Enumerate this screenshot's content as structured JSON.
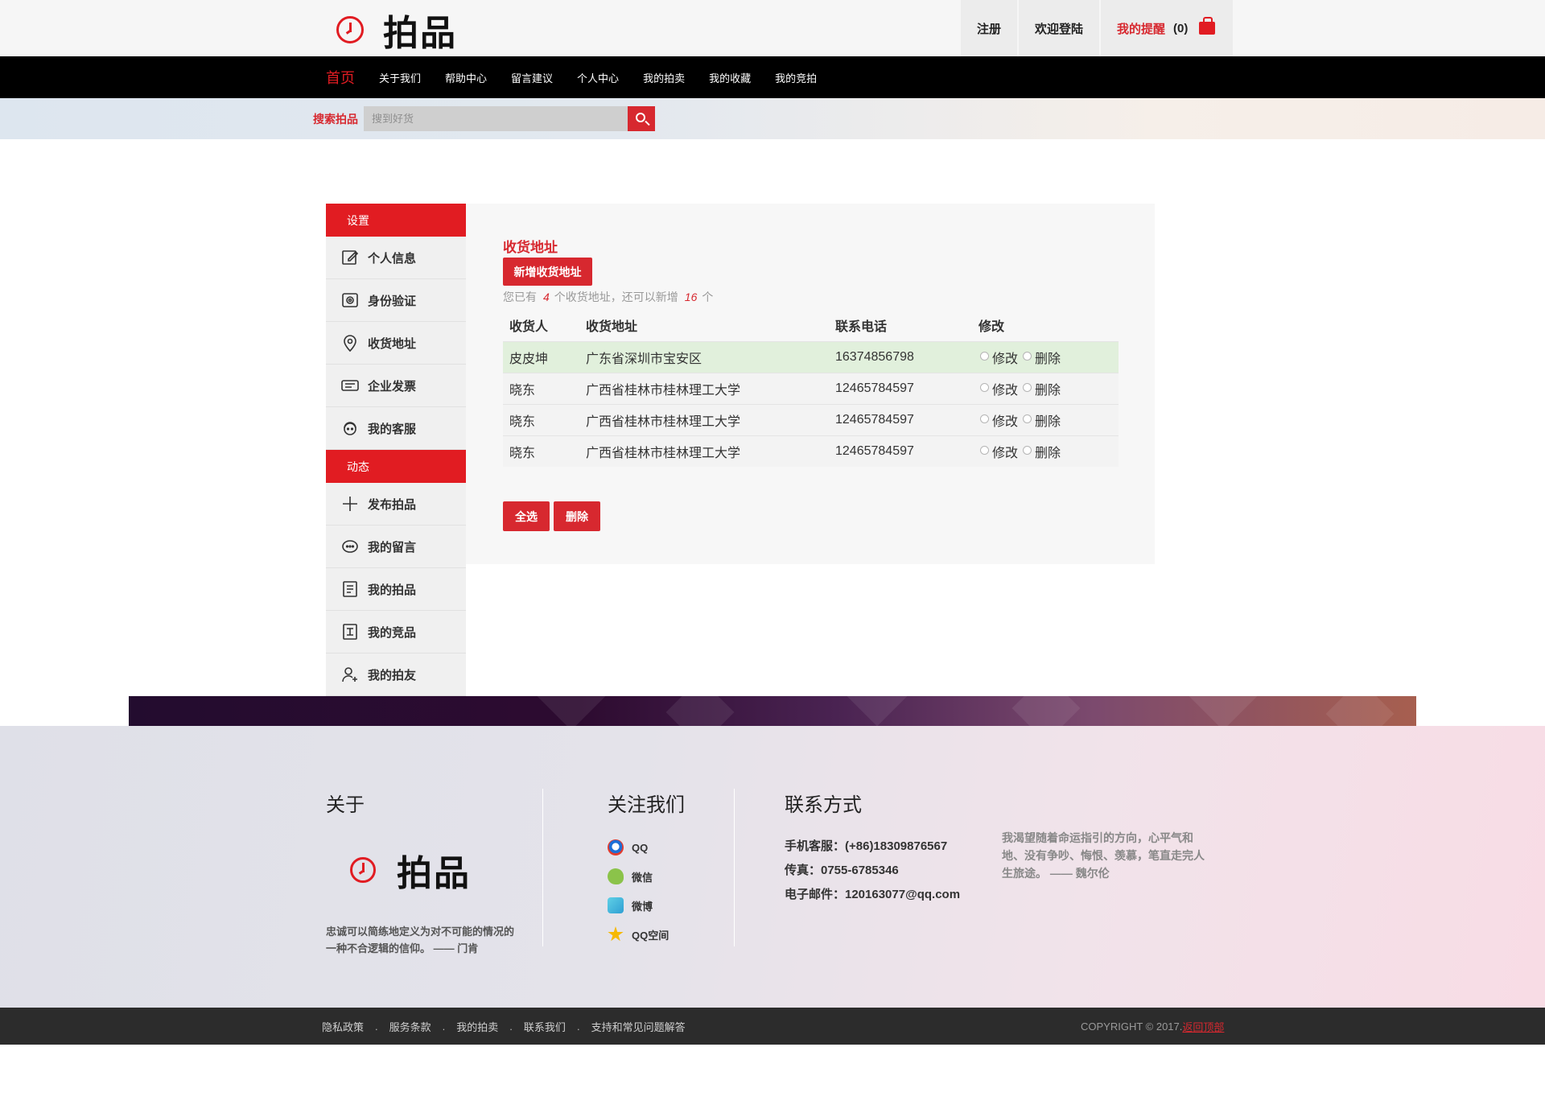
{
  "header": {
    "logo_text": "拍品",
    "register": "注册",
    "login": "欢迎登陆",
    "remind": "我的提醒",
    "remind_count": "(0)"
  },
  "nav": {
    "items": [
      "首页",
      "关于我们",
      "帮助中心",
      "留言建议",
      "个人中心",
      "我的拍卖",
      "我的收藏",
      "我的竞拍"
    ]
  },
  "search": {
    "label": "搜索拍品",
    "placeholder": "搜到好货"
  },
  "sidebar": {
    "section1": "设置",
    "items1": [
      {
        "label": "个人信息",
        "icon": "edit-icon"
      },
      {
        "label": "身份验证",
        "icon": "camera-icon"
      },
      {
        "label": "收货地址",
        "icon": "location-pin-icon"
      },
      {
        "label": "企业发票",
        "icon": "invoice-icon"
      },
      {
        "label": "我的客服",
        "icon": "customer-service-icon"
      }
    ],
    "section2": "动态",
    "items2": [
      {
        "label": "发布拍品",
        "icon": "plus-icon"
      },
      {
        "label": "我的留言",
        "icon": "chat-bubble-icon"
      },
      {
        "label": "我的拍品",
        "icon": "auction-item-icon"
      },
      {
        "label": "我的竞品",
        "icon": "bid-item-icon"
      },
      {
        "label": "我的拍友",
        "icon": "add-friend-icon"
      }
    ]
  },
  "panel": {
    "title": "收货地址",
    "add_button": "新增收货地址",
    "hint_prefix": "您已有",
    "hint_count": "4",
    "hint_mid": "个收货地址，还可以新增",
    "hint_remaining": "16",
    "hint_suffix": "个",
    "columns": [
      "收货人",
      "收货地址",
      "联系电话",
      "修改"
    ],
    "rows": [
      {
        "name": "皮皮坤",
        "address": "广东省深圳市宝安区",
        "phone": "16374856798",
        "edit": "修改",
        "delete": "删除"
      },
      {
        "name": "晓东",
        "address": "广西省桂林市桂林理工大学",
        "phone": "12465784597",
        "edit": "修改",
        "delete": "删除"
      },
      {
        "name": "晓东",
        "address": "广西省桂林市桂林理工大学",
        "phone": "12465784597",
        "edit": "修改",
        "delete": "删除"
      },
      {
        "name": "晓东",
        "address": "广西省桂林市桂林理工大学",
        "phone": "12465784597",
        "edit": "修改",
        "delete": "删除"
      }
    ],
    "select_all": "全选",
    "delete_button": "删除"
  },
  "footer": {
    "about_head": "关于",
    "about_logo": "拍品",
    "about_quote_1": "忠诚可以简练地定义为对不可能的情况的",
    "about_quote_2": "一种不合逻辑的信仰。 —— 门肯",
    "follow_head": "关注我们",
    "follow_items": [
      {
        "label": "QQ",
        "icon": "qq-icon"
      },
      {
        "label": "微信",
        "icon": "wechat-icon"
      },
      {
        "label": "微博",
        "icon": "weibo-icon"
      },
      {
        "label": "QQ空间",
        "icon": "qzone-icon"
      }
    ],
    "contact_head": "联系方式",
    "contact_phone": "手机客服：(+86)18309876567",
    "contact_fax": "传真：0755-6785346",
    "contact_email": "电子邮件：120163077@qq.com",
    "motto_1": "我渴望随着命运指引的方向，心平气和",
    "motto_2": "地、没有争吵、悔恨、羡慕，笔直走完人",
    "motto_3": "生旅途。 —— 魏尔伦"
  },
  "bottom": {
    "links": [
      "隐私政策",
      "服务条款",
      "我的拍卖",
      "联系我们",
      "支持和常见问题解答"
    ],
    "separator": ".",
    "copyright": "COPYRIGHT © 2017.",
    "back_to_top": "返回顶部"
  },
  "colors": {
    "accent": "#d7282f",
    "nav_bg": "#000000",
    "bottom_bg": "#2c2c2c"
  }
}
